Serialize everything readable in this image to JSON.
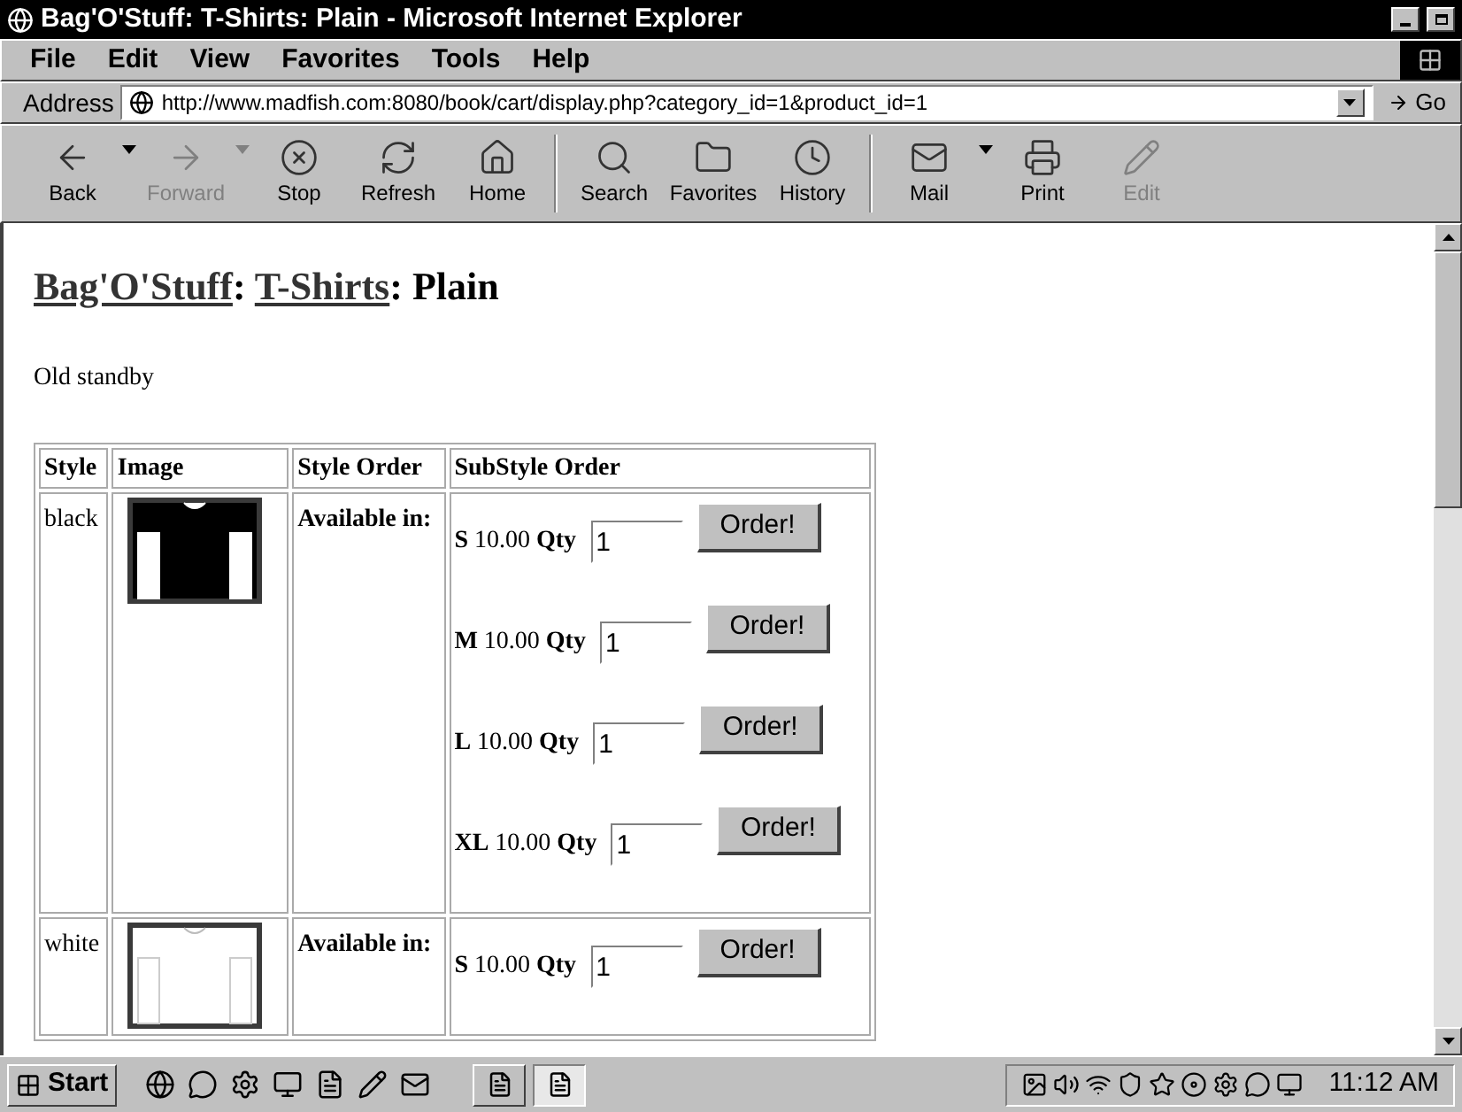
{
  "window": {
    "title": "Bag'O'Stuff: T-Shirts: Plain - Microsoft Internet Explorer"
  },
  "menu": [
    "File",
    "Edit",
    "View",
    "Favorites",
    "Tools",
    "Help"
  ],
  "address": {
    "label": "Address",
    "url": "http://www.madfish.com:8080/book/cart/display.php?category_id=1&product_id=1",
    "go": "Go"
  },
  "toolbar": [
    {
      "kind": "back",
      "label": "Back",
      "disabled": false,
      "dropdown": true
    },
    {
      "kind": "forward",
      "label": "Forward",
      "disabled": true,
      "dropdown": true
    },
    {
      "kind": "stop",
      "label": "Stop",
      "disabled": false,
      "dropdown": false
    },
    {
      "kind": "refresh",
      "label": "Refresh",
      "disabled": false,
      "dropdown": false
    },
    {
      "kind": "home",
      "label": "Home",
      "disabled": false,
      "dropdown": false
    },
    {
      "kind": "separator"
    },
    {
      "kind": "search",
      "label": "Search",
      "disabled": false,
      "dropdown": false
    },
    {
      "kind": "favorites",
      "label": "Favorites",
      "disabled": false,
      "dropdown": false
    },
    {
      "kind": "history",
      "label": "History",
      "disabled": false,
      "dropdown": false
    },
    {
      "kind": "separator"
    },
    {
      "kind": "mail",
      "label": "Mail",
      "disabled": false,
      "dropdown": true
    },
    {
      "kind": "print",
      "label": "Print",
      "disabled": false,
      "dropdown": false
    },
    {
      "kind": "edit",
      "label": "Edit",
      "disabled": true,
      "dropdown": false
    }
  ],
  "page": {
    "heading": [
      {
        "text": "Bag'O'Stuff",
        "link": true
      },
      {
        "text": ": ",
        "link": false
      },
      {
        "text": "T-Shirts",
        "link": true
      },
      {
        "text": ": Plain",
        "link": false
      }
    ],
    "description": "Old standby",
    "table": {
      "columns": [
        "Style",
        "Image",
        "Style Order",
        "SubStyle Order"
      ],
      "rows": [
        {
          "style": "black",
          "color": "#000000",
          "available": "Available in:",
          "substyles": [
            {
              "size": "S",
              "price": "10.00",
              "qty_label": "Qty",
              "qty": "1",
              "button": "Order!"
            },
            {
              "size": "M",
              "price": "10.00",
              "qty_label": "Qty",
              "qty": "1",
              "button": "Order!"
            },
            {
              "size": "L",
              "price": "10.00",
              "qty_label": "Qty",
              "qty": "1",
              "button": "Order!"
            },
            {
              "size": "XL",
              "price": "10.00",
              "qty_label": "Qty",
              "qty": "1",
              "button": "Order!"
            }
          ]
        },
        {
          "style": "white",
          "color": "#ffffff",
          "available": "Available in:",
          "substyles": [
            {
              "size": "S",
              "price": "10.00",
              "qty_label": "Qty",
              "qty": "1",
              "button": "Order!"
            }
          ]
        }
      ]
    }
  },
  "taskbar": {
    "start": "Start",
    "tasks": [
      {
        "selected": false
      },
      {
        "selected": true
      }
    ],
    "clock": "11:12 AM"
  }
}
